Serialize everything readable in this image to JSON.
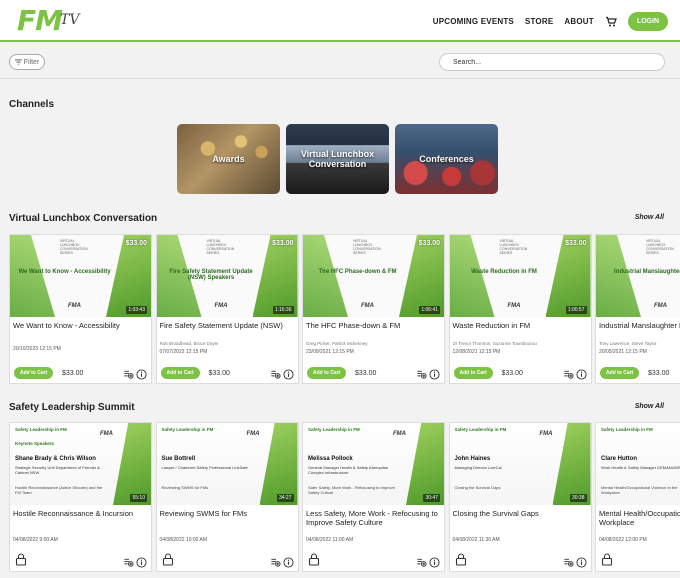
{
  "header": {
    "logo_text": "FM",
    "logo_suffix": "TV",
    "nav": [
      "UPCOMING EVENTS",
      "STORE",
      "ABOUT"
    ],
    "login_label": "LOGIN"
  },
  "toolbar": {
    "filter_label": "Filter",
    "search_placeholder": "Search..."
  },
  "channels": {
    "heading": "Channels",
    "items": [
      "Awards",
      "Virtual Lunchbox Conversation",
      "Conferences"
    ]
  },
  "lunchbox": {
    "heading": "Virtual Lunchbox Conversation",
    "show_all": "Show All",
    "cards": [
      {
        "thumb_title": "We Want to Know - Accessibility",
        "price_badge": "$33.00",
        "duration": "1:03:43",
        "title": "We Want to Know - Accessibility",
        "presenters": "",
        "date": "20/10/2023   12:15 PM",
        "add_label": "Add to Cart",
        "price": "$33.00"
      },
      {
        "thumb_title": "Fire Safety Statement Update (NSW) Speakers",
        "price_badge": "$33.00",
        "duration": "1:16:36",
        "title": "Fire Safety Statement Update (NSW)",
        "presenters": "Rob Broadhead, Bruce Doyle",
        "date": "07/07/2022   12:15 PM",
        "add_label": "Add to Cart",
        "price": "$33.00"
      },
      {
        "thumb_title": "The HFC Phase-down & FM",
        "price_badge": "$33.00",
        "duration": "1:06:41",
        "title": "The HFC Phase-down & FM",
        "presenters": "Greg Picker, Patrick Mckenney",
        "date": "23/09/2021   12:15 PM",
        "add_label": "Add to Cart",
        "price": "$33.00"
      },
      {
        "thumb_title": "Waste Reduction in FM",
        "price_badge": "$33.00",
        "duration": "1:00:57",
        "title": "Waste Reduction in FM",
        "presenters": "Dr Trevor Thornton, Suzanne Toumbourou",
        "date": "12/08/2021   12:15 PM",
        "add_label": "Add to Cart",
        "price": "$33.00"
      },
      {
        "thumb_title": "Industrial Manslaughter L",
        "price_badge": "$33.00",
        "duration": "",
        "title": "Industrial Manslaughter L",
        "presenters": "Tony Lawrence, Steve Taylor",
        "date": "20/05/2021   12:15 PM",
        "add_label": "Add to Cart",
        "price": "$33.00"
      }
    ]
  },
  "safety": {
    "heading": "Safety Leadership Summit",
    "show_all": "Show All",
    "series_label": "Safety Leadership in FM",
    "cards": [
      {
        "keynote": "Keynote Speakers",
        "name": "Shane Brady & Chris Wilson",
        "role": "Strategic Security Unit Department of Premier & Cabinet NSW",
        "topic": "Hostile Reconnaissance (Active Shooter) and the FM Team",
        "duration": "55:10",
        "title": "Hostile Reconnaissance & Incursion",
        "date": "04/08/2022   9:00 AM"
      },
      {
        "keynote": "",
        "name": "Sue Bottrell",
        "role": "Lawyer / Chartered Safety Professional LinkSafe",
        "topic": "Reviewing SWMS for FMs",
        "duration": "34:27",
        "title": "Reviewing SWMS for FMs",
        "date": "04/08/2022   10:00 AM"
      },
      {
        "keynote": "",
        "name": "Melissa Pollock",
        "role": "General Manager Health & Safety Aberquilan Complex Infrastructure",
        "topic": "Safer Safety, More Work - Refocusing to Improve Safety Culture",
        "duration": "30:47",
        "title": "Less Safety, More Work - Refocusing to Improve Safety Culture",
        "date": "04/08/2022   11:00 AM"
      },
      {
        "keynote": "",
        "name": "John Haines",
        "role": "Managing Director LiveCal",
        "topic": "Closing the Survival Gaps",
        "duration": "30:38",
        "title": "Closing the Survival Gaps",
        "date": "04/08/2022   11:30 AM"
      },
      {
        "keynote": "",
        "name": "Clare Hutton",
        "role": "Work Health & Safety Manager DEMANUMS",
        "topic": "Mental Health/Occupational Violence in the Workplace",
        "duration": "",
        "title": "Mental Health/Occupation the Workplace",
        "date": "04/08/2022   12:00 PM"
      }
    ]
  },
  "colors": {
    "brand_green": "#7dc242"
  }
}
